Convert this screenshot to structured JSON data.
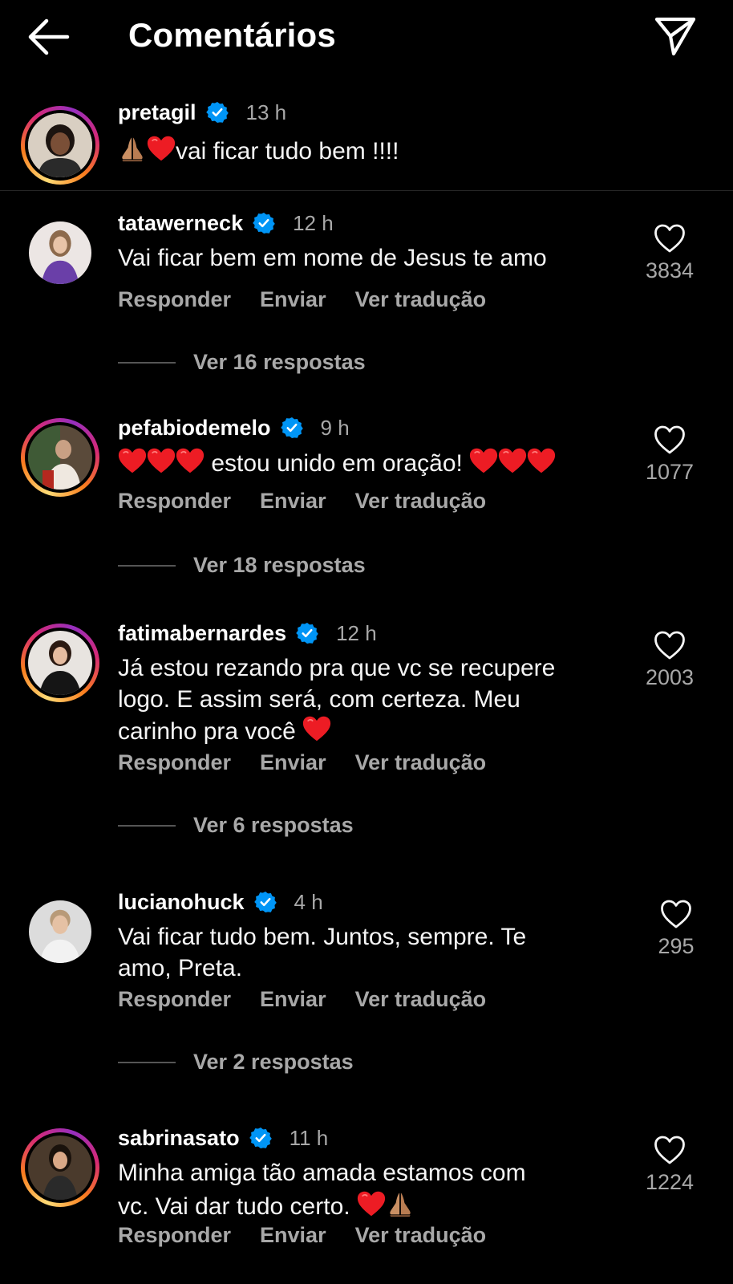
{
  "header": {
    "title": "Comentários",
    "back_icon": "arrow-left-icon",
    "send_icon": "send-paper-plane-icon"
  },
  "caption": {
    "username": "pretagil",
    "time": "13 h",
    "text": "vai ficar tudo bem !!!!",
    "emoji_prefix": [
      "folded-hands-icon",
      "red-heart-icon"
    ]
  },
  "actions": {
    "reply": "Responder",
    "send": "Enviar",
    "translate": "Ver tradução"
  },
  "comments": [
    {
      "username": "tatawerneck",
      "time": "12 h",
      "text": "Vai ficar bem em nome de Jesus te amo",
      "likes": "3834",
      "replies": "Ver 16 respostas"
    },
    {
      "username": "pefabiodemelo",
      "time": "9 h",
      "text": "estou unido em oração!",
      "likes": "1077",
      "replies": "Ver 18 respostas"
    },
    {
      "username": "fatimabernardes",
      "time": "12 h",
      "text_lines": [
        "Já estou rezando pra que vc se recupere",
        "logo. E assim será, com certeza. Meu",
        "carinho pra você"
      ],
      "likes": "2003",
      "replies": "Ver 6 respostas"
    },
    {
      "username": "lucianohuck",
      "time": "4 h",
      "text_lines": [
        "Vai ficar tudo bem. Juntos, sempre. Te",
        "amo, Preta."
      ],
      "likes": "295",
      "replies": "Ver 2 respostas"
    },
    {
      "username": "sabrinasato",
      "time": "11 h",
      "text_lines": [
        "Minha amiga tão amada estamos com",
        "vc. Vai dar tudo certo."
      ],
      "likes": "1224"
    }
  ],
  "colors": {
    "background": "#000000",
    "text": "#f5f5f5",
    "muted": "#a8a8a8",
    "verified": "#0095f6",
    "heart": "#ed1c24"
  }
}
